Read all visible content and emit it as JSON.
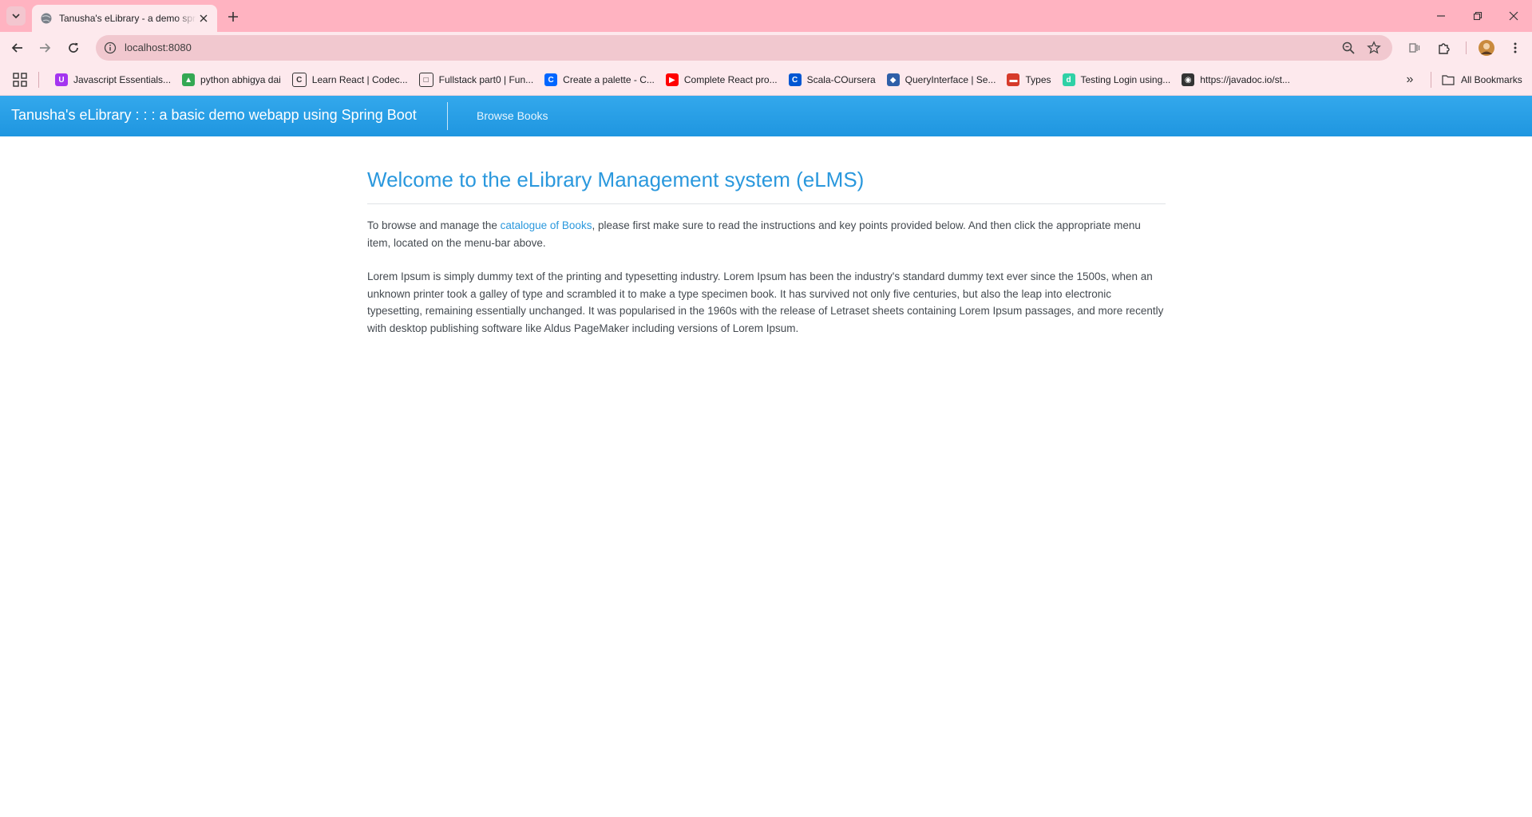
{
  "browser": {
    "tab_title": "Tanusha's eLibrary - a demo spring",
    "url": "localhost:8080",
    "bookmarks": [
      {
        "label": "Javascript Essentials...",
        "icon": "udemy-icon",
        "color": "#a435f0",
        "glyph": "U"
      },
      {
        "label": "python abhigya dai",
        "icon": "google-drive-icon",
        "color": "#34a853",
        "glyph": "▲"
      },
      {
        "label": "Learn React | Codec...",
        "icon": "codecademy-icon",
        "color": "#ffffff",
        "glyph": "C"
      },
      {
        "label": "Fullstack part0 | Fun...",
        "icon": "fullstack-icon",
        "color": "#ffffff",
        "glyph": "□"
      },
      {
        "label": "Create a palette - C...",
        "icon": "coolors-icon",
        "color": "#0066ff",
        "glyph": "C"
      },
      {
        "label": "Complete React pro...",
        "icon": "youtube-icon",
        "color": "#ff0000",
        "glyph": "▶"
      },
      {
        "label": "Scala-COursera",
        "icon": "coursera-icon",
        "color": "#0056d2",
        "glyph": "C"
      },
      {
        "label": "QueryInterface | Se...",
        "icon": "sequelize-icon",
        "color": "#2f5fa8",
        "glyph": "◆"
      },
      {
        "label": "Types",
        "icon": "types-icon",
        "color": "#d63a2a",
        "glyph": "▬"
      },
      {
        "label": "Testing Login using...",
        "icon": "dev-icon",
        "color": "#2fd1a6",
        "glyph": "d"
      },
      {
        "label": "https://javadoc.io/st...",
        "icon": "globe-icon",
        "color": "#333333",
        "glyph": "◉"
      }
    ],
    "all_bookmarks": "All Bookmarks"
  },
  "app": {
    "brand": "Tanusha's eLibrary : : : a basic demo webapp using Spring Boot",
    "menu": {
      "browse_books": "Browse Books"
    }
  },
  "main": {
    "heading": "Welcome to the eLibrary Management system (eLMS)",
    "intro_before": "To browse and manage the ",
    "intro_link": "catalogue of Books",
    "intro_after": ", please first make sure to read the instructions and key points provided below. And then click the appropriate menu item, located on the menu-bar above.",
    "lorem": "Lorem Ipsum is simply dummy text of the printing and typesetting industry. Lorem Ipsum has been the industry's standard dummy text ever since the 1500s, when an unknown printer took a galley of type and scrambled it to make a type specimen book. It has survived not only five centuries, but also the leap into electronic typesetting, remaining essentially unchanged. It was popularised in the 1960s with the release of Letraset sheets containing Lorem Ipsum passages, and more recently with desktop publishing software like Aldus PageMaker including versions of Lorem Ipsum."
  },
  "colors": {
    "chrome_frame": "#ffb3c1",
    "appbar": "#2a9fe6",
    "accent": "#2a98dd"
  }
}
